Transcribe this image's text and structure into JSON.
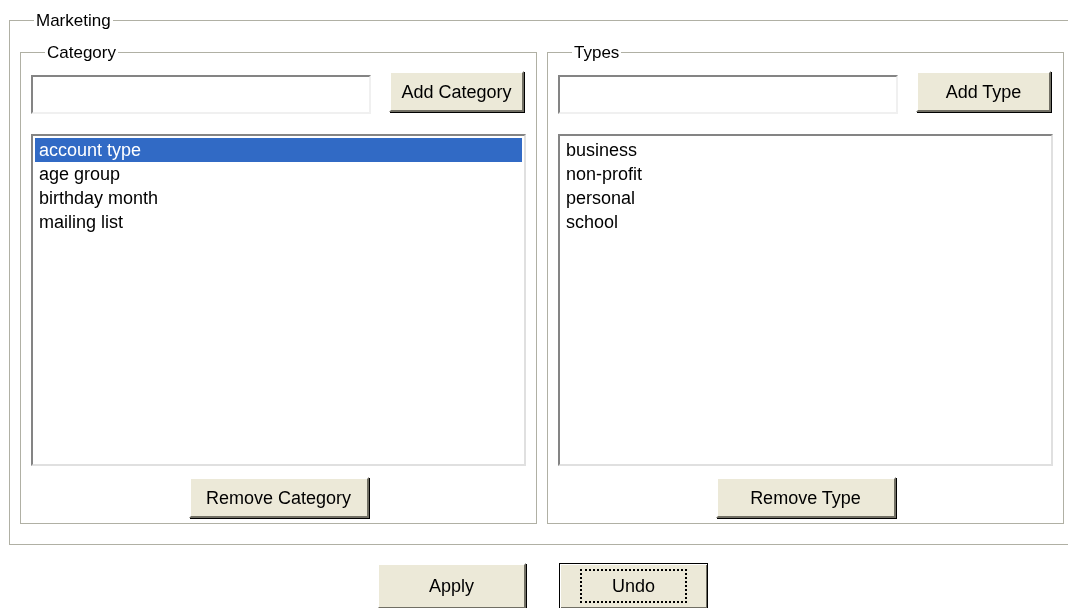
{
  "group": {
    "title": "Marketing"
  },
  "panels": [
    {
      "title": "Category",
      "add_button": "Add Category",
      "items": [
        {
          "label": "account type",
          "selected": true
        },
        {
          "label": "age group",
          "selected": false
        },
        {
          "label": "birthday month",
          "selected": false
        },
        {
          "label": "mailing list",
          "selected": false
        }
      ],
      "remove_button": "Remove Category"
    },
    {
      "title": "Types",
      "add_button": "Add Type",
      "items": [
        {
          "label": "business",
          "selected": false
        },
        {
          "label": "non-profit",
          "selected": false
        },
        {
          "label": "personal",
          "selected": false
        },
        {
          "label": "school",
          "selected": false
        }
      ],
      "remove_button": "Remove Type"
    }
  ],
  "buttons": [
    {
      "label": "Apply",
      "focused": false
    },
    {
      "label": "Undo",
      "focused": true
    }
  ]
}
